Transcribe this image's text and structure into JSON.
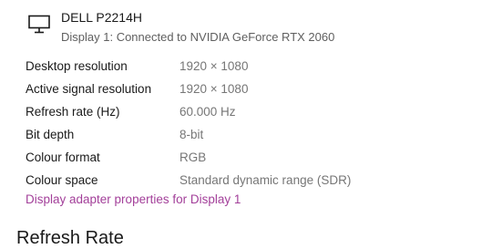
{
  "display": {
    "icon": "monitor-icon",
    "name": "DELL P2214H",
    "subtitle": "Display 1: Connected to NVIDIA GeForce RTX 2060"
  },
  "info": [
    {
      "label": "Desktop resolution",
      "value": "1920 × 1080"
    },
    {
      "label": "Active signal resolution",
      "value": "1920 × 1080"
    },
    {
      "label": "Refresh rate (Hz)",
      "value": "60.000 Hz"
    },
    {
      "label": "Bit depth",
      "value": "8-bit"
    },
    {
      "label": "Colour format",
      "value": "RGB"
    },
    {
      "label": "Colour space",
      "value": "Standard dynamic range (SDR)"
    }
  ],
  "adapter_link": "Display adapter properties for Display 1",
  "section_heading": "Refresh Rate",
  "colors": {
    "link": "#a3409a",
    "value_text": "#767676",
    "subtitle_text": "#5f5f5f"
  }
}
